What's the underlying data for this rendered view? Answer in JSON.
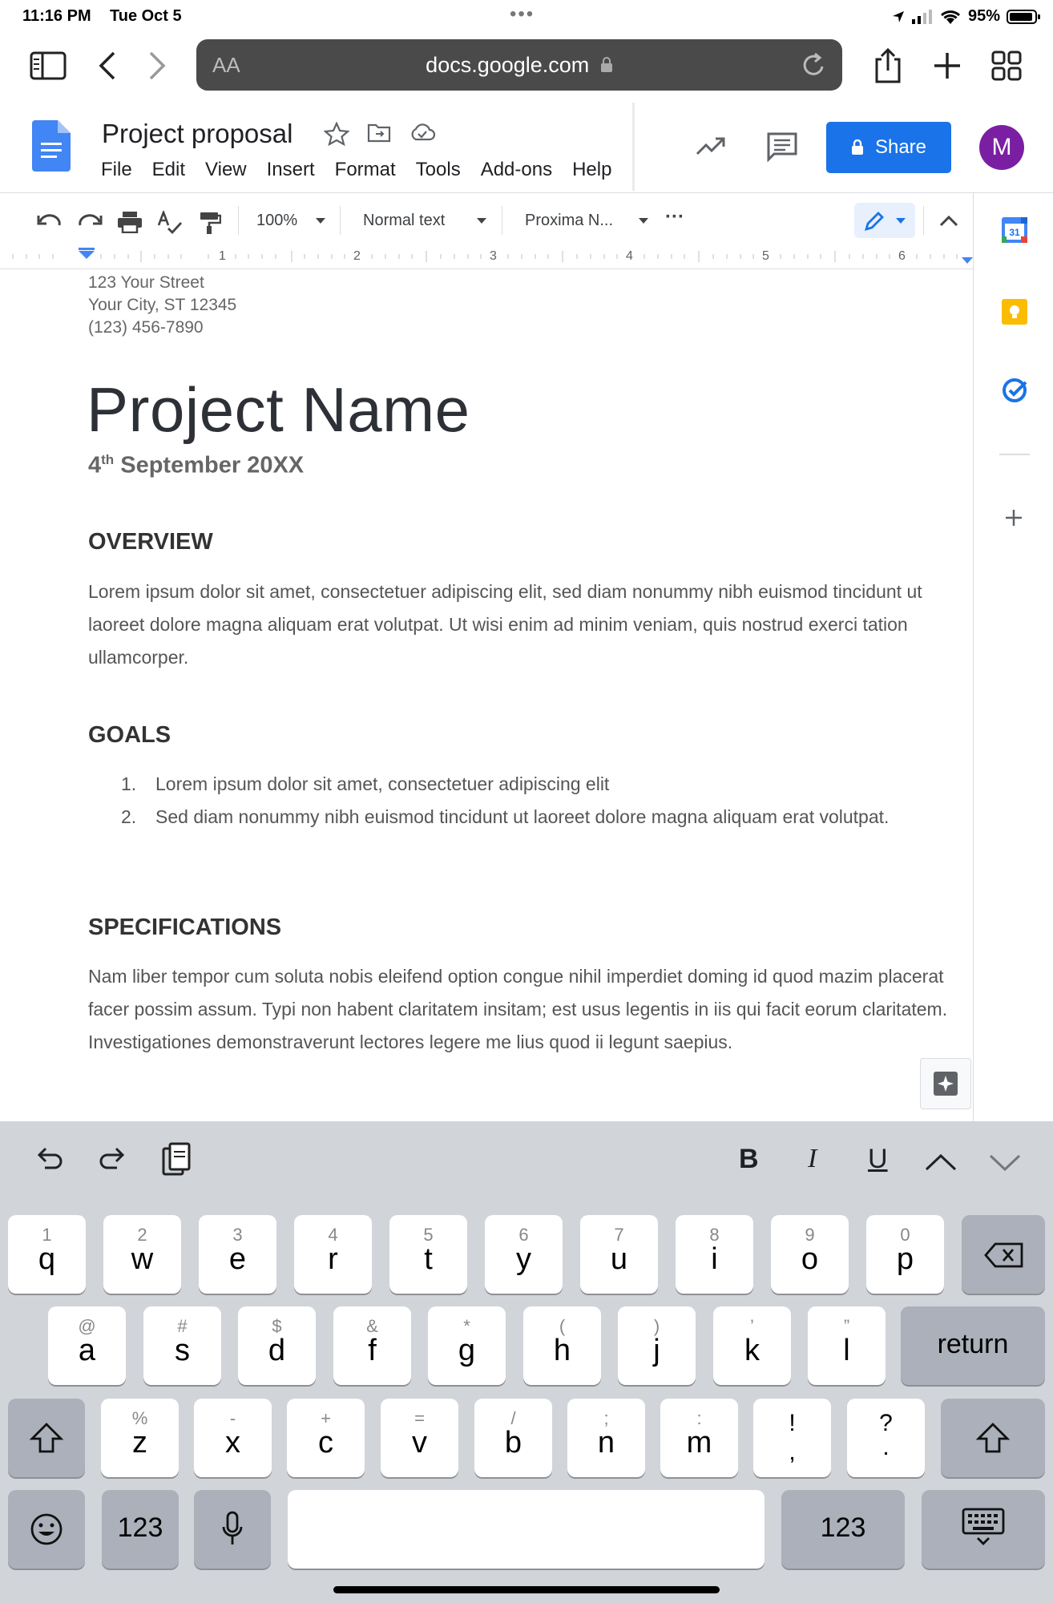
{
  "status_bar": {
    "time": "11:16 PM",
    "date": "Tue Oct 5",
    "battery": "95%"
  },
  "browser": {
    "text_size_label": "AA",
    "url": "docs.google.com"
  },
  "docs": {
    "title": "Project proposal",
    "menu": [
      "File",
      "Edit",
      "View",
      "Insert",
      "Format",
      "Tools",
      "Add-ons",
      "Help"
    ],
    "share_label": "Share",
    "avatar_letter": "M"
  },
  "toolbar": {
    "zoom": "100%",
    "style": "Normal text",
    "font": "Proxima N..."
  },
  "ruler": {
    "numbers": [
      "1",
      "2",
      "3",
      "4",
      "5",
      "6"
    ]
  },
  "side_panel": {
    "calendar_day": "31"
  },
  "document": {
    "address": [
      "123 Your Street",
      "Your City, ST 12345",
      "(123) 456-7890"
    ],
    "project_name": "Project Name",
    "date_day": "4",
    "date_suffix": "th",
    "date_rest": " September 20XX",
    "overview_heading": "OVERVIEW",
    "overview_text": "Lorem ipsum dolor sit amet, consectetuer adipiscing elit, sed diam nonummy nibh euismod tincidunt ut laoreet dolore magna aliquam erat volutpat. Ut wisi enim ad minim veniam, quis nostrud exerci tation ullamcorper.",
    "goals_heading": "GOALS",
    "goals": [
      {
        "num": "1.",
        "text": "Lorem ipsum dolor sit amet, consectetuer adipiscing elit"
      },
      {
        "num": "2.",
        "text": "Sed diam nonummy nibh euismod tincidunt ut laoreet dolore magna aliquam erat volutpat."
      }
    ],
    "specs_heading": "SPECIFICATIONS",
    "specs_text": "Nam liber tempor cum soluta nobis eleifend option congue nihil imperdiet doming id quod mazim placerat facer possim assum. Typi non habent claritatem insitam; est usus legentis in iis qui facit eorum claritatem. Investigationes demonstraverunt lectores legere me lius quod ii legunt saepius."
  },
  "keyboard": {
    "format": {
      "bold": "B",
      "italic": "I",
      "underline": "U"
    },
    "row1": [
      [
        "1",
        "q"
      ],
      [
        "2",
        "w"
      ],
      [
        "3",
        "e"
      ],
      [
        "4",
        "r"
      ],
      [
        "5",
        "t"
      ],
      [
        "6",
        "y"
      ],
      [
        "7",
        "u"
      ],
      [
        "8",
        "i"
      ],
      [
        "9",
        "o"
      ],
      [
        "0",
        "p"
      ]
    ],
    "row2": [
      [
        "@",
        "a"
      ],
      [
        "#",
        "s"
      ],
      [
        "$",
        "d"
      ],
      [
        "&",
        "f"
      ],
      [
        "*",
        "g"
      ],
      [
        "(",
        "h"
      ],
      [
        ")",
        "j"
      ],
      [
        "’",
        "k"
      ],
      [
        "”",
        "l"
      ]
    ],
    "row3": [
      [
        "%",
        "z"
      ],
      [
        "-",
        "x"
      ],
      [
        "+",
        "c"
      ],
      [
        "=",
        "v"
      ],
      [
        "/",
        "b"
      ],
      [
        ";",
        "n"
      ],
      [
        ":",
        "m"
      ]
    ],
    "punct1": [
      "!",
      ","
    ],
    "punct2": [
      "?",
      "."
    ],
    "return_label": "return",
    "numbers_label": "123"
  },
  "colors": {
    "accent": "#1a73e8",
    "avatar": "#7b1fa2",
    "keyboard_bg": "#d1d4d9"
  }
}
